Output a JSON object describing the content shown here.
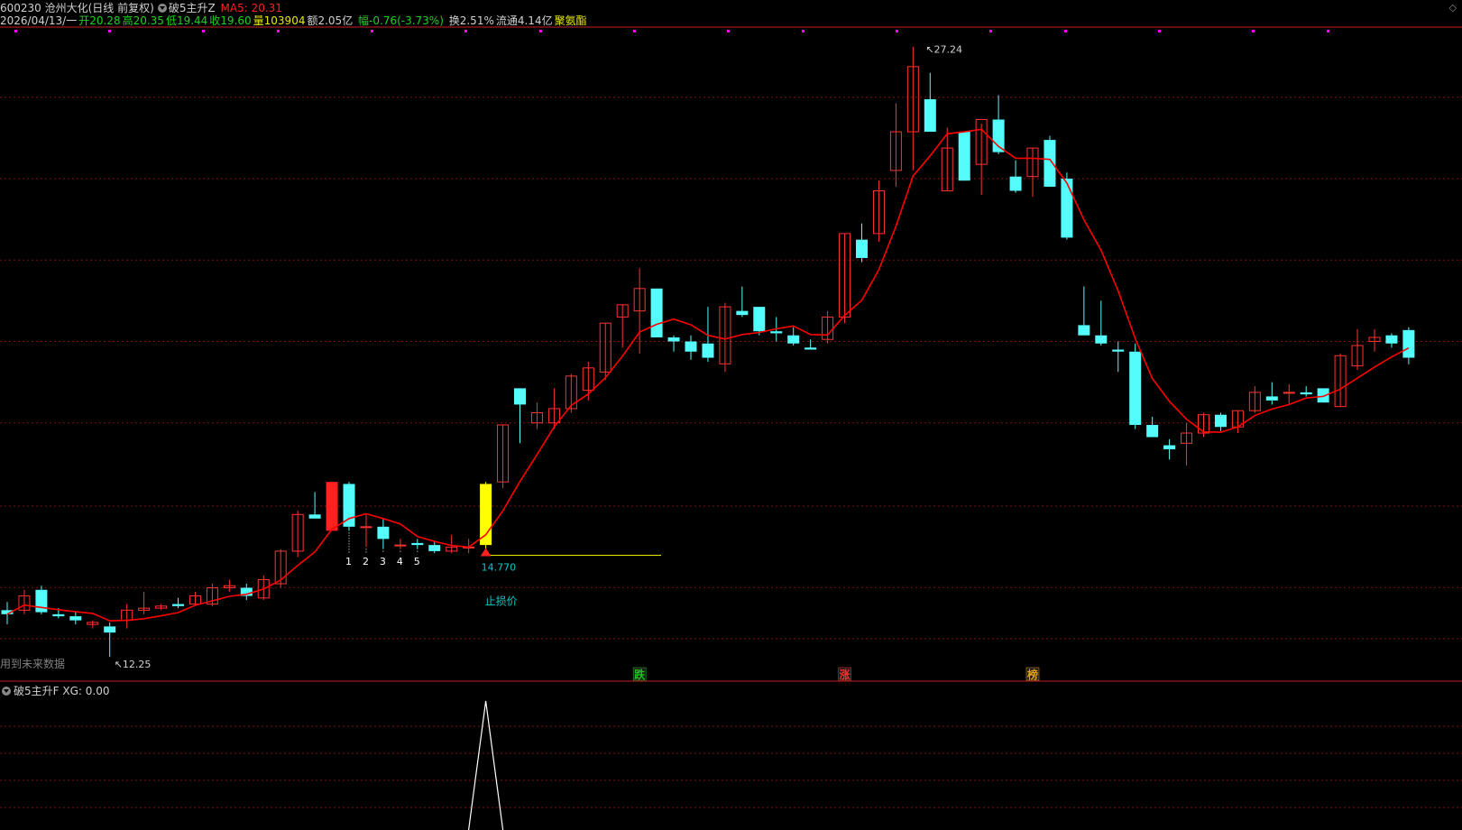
{
  "header": {
    "code_name": "600230 沧州大化(日线 前复权)",
    "indicator_name": "破5主升Z",
    "ma_label": "MA5: 20.31",
    "date": "2026/04/13/一",
    "open": "开20.28",
    "high": "高20.35",
    "low": "低19.44",
    "close": "收19.60",
    "volume": "量103904",
    "amount": "额2.05亿",
    "change": "幅-0.76(-3.73%)",
    "turnover": "换2.51%",
    "float_cap": "流通4.14亿",
    "concept": "聚氨酯"
  },
  "sub_panel": {
    "name": "破5主升F",
    "value": "XG: 0.00"
  },
  "note": "用到未来数据",
  "corner_icon": "diamond-icon",
  "colors": {
    "up": "#ff3232",
    "down": "#54fcfc",
    "ma": "#ff0000",
    "signal": "#ffff00",
    "grid": "#801010",
    "text_cyan": "#00c8c8"
  },
  "chart_data": [
    {
      "type": "candlestick",
      "ohlc": [
        [
          13.4,
          13.6,
          13.05,
          13.3
        ],
        [
          13.4,
          13.9,
          13.3,
          13.75
        ],
        [
          13.9,
          14.0,
          13.3,
          13.35
        ],
        [
          13.3,
          13.45,
          13.2,
          13.25
        ],
        [
          13.25,
          13.35,
          13.05,
          13.15
        ],
        [
          13.05,
          13.15,
          12.95,
          13.1
        ],
        [
          13.0,
          13.1,
          12.25,
          12.85
        ],
        [
          13.15,
          13.55,
          12.95,
          13.4
        ],
        [
          13.4,
          13.85,
          13.3,
          13.45
        ],
        [
          13.45,
          13.55,
          13.4,
          13.5
        ],
        [
          13.55,
          13.7,
          13.45,
          13.5
        ],
        [
          13.55,
          13.85,
          13.5,
          13.75
        ],
        [
          13.55,
          14.05,
          13.5,
          13.95
        ],
        [
          13.95,
          14.15,
          13.85,
          14.0
        ],
        [
          13.95,
          14.05,
          13.65,
          13.75
        ],
        [
          13.7,
          14.25,
          13.65,
          14.15
        ],
        [
          14.05,
          14.9,
          13.95,
          14.85
        ],
        [
          14.85,
          15.85,
          14.7,
          15.75
        ],
        [
          15.75,
          16.3,
          15.7,
          15.65
        ],
        [
          15.35,
          16.55,
          15.35,
          16.55
        ],
        [
          16.5,
          16.55,
          15.35,
          15.45
        ],
        [
          15.45,
          15.75,
          14.95,
          15.45
        ],
        [
          15.45,
          15.65,
          14.9,
          15.15
        ],
        [
          15.0,
          15.15,
          14.9,
          15.0
        ],
        [
          15.05,
          15.15,
          14.9,
          15.0
        ],
        [
          15.0,
          15.1,
          14.8,
          14.85
        ],
        [
          14.85,
          15.25,
          14.8,
          14.95
        ],
        [
          14.95,
          15.15,
          14.8,
          14.95
        ],
        [
          15.0,
          16.55,
          14.85,
          16.5
        ],
        [
          16.55,
          17.95,
          16.4,
          17.95
        ],
        [
          18.85,
          18.85,
          17.5,
          18.45
        ],
        [
          18.0,
          18.5,
          17.85,
          18.25
        ],
        [
          18.0,
          18.85,
          17.85,
          18.35
        ],
        [
          18.35,
          19.2,
          18.25,
          19.15
        ],
        [
          18.8,
          19.5,
          18.55,
          19.35
        ],
        [
          19.25,
          20.45,
          19.05,
          20.45
        ],
        [
          20.6,
          20.9,
          19.85,
          20.9
        ],
        [
          20.75,
          21.8,
          19.7,
          21.3
        ],
        [
          21.3,
          21.25,
          20.35,
          20.1
        ],
        [
          20.1,
          20.15,
          19.75,
          20.0
        ],
        [
          20.0,
          20.15,
          19.55,
          19.75
        ],
        [
          19.95,
          20.85,
          19.5,
          19.6
        ],
        [
          19.45,
          20.95,
          19.25,
          20.85
        ],
        [
          20.75,
          21.35,
          20.6,
          20.65
        ],
        [
          20.85,
          20.85,
          20.15,
          20.25
        ],
        [
          20.25,
          20.6,
          20.0,
          20.2
        ],
        [
          20.15,
          20.35,
          19.9,
          19.95
        ],
        [
          19.85,
          20.05,
          19.8,
          19.8
        ],
        [
          20.05,
          20.75,
          19.95,
          20.6
        ],
        [
          20.6,
          22.65,
          20.45,
          22.65
        ],
        [
          22.5,
          22.9,
          21.95,
          22.05
        ],
        [
          22.65,
          23.95,
          22.45,
          23.7
        ],
        [
          24.2,
          25.85,
          23.8,
          25.15
        ],
        [
          25.15,
          27.24,
          24.2,
          26.75
        ],
        [
          25.95,
          26.6,
          25.35,
          25.15
        ],
        [
          23.7,
          25.25,
          23.7,
          24.75
        ],
        [
          25.15,
          25.05,
          23.95,
          23.95
        ],
        [
          24.35,
          25.35,
          23.6,
          25.45
        ],
        [
          25.45,
          26.05,
          24.6,
          24.65
        ],
        [
          24.05,
          24.45,
          23.65,
          23.7
        ],
        [
          24.05,
          24.75,
          23.55,
          24.75
        ],
        [
          24.95,
          25.05,
          24.05,
          23.8
        ],
        [
          24.0,
          24.15,
          22.5,
          22.55
        ],
        [
          20.4,
          21.35,
          20.3,
          20.15
        ],
        [
          20.15,
          21.0,
          19.9,
          19.95
        ],
        [
          19.8,
          20.0,
          19.25,
          19.75
        ],
        [
          19.75,
          19.95,
          17.85,
          17.95
        ],
        [
          17.95,
          18.15,
          17.65,
          17.65
        ],
        [
          17.45,
          17.6,
          17.1,
          17.35
        ],
        [
          17.5,
          18.0,
          16.95,
          17.75
        ],
        [
          17.75,
          18.25,
          17.65,
          18.2
        ],
        [
          18.2,
          18.25,
          17.8,
          17.9
        ],
        [
          17.9,
          18.3,
          17.75,
          18.3
        ],
        [
          18.3,
          18.9,
          18.25,
          18.75
        ],
        [
          18.65,
          19.0,
          18.45,
          18.55
        ],
        [
          18.75,
          18.95,
          18.45,
          18.75
        ],
        [
          18.75,
          18.9,
          18.65,
          18.7
        ],
        [
          18.85,
          18.65,
          18.5,
          18.5
        ],
        [
          18.4,
          19.7,
          18.4,
          19.65
        ],
        [
          19.4,
          20.3,
          19.3,
          19.9
        ],
        [
          20.0,
          20.3,
          19.75,
          20.1
        ],
        [
          20.15,
          20.2,
          19.85,
          19.95
        ],
        [
          20.28,
          20.35,
          19.44,
          19.6
        ]
      ],
      "ma5_label": "MA5",
      "high_label": "27.24",
      "low_label": "12.25",
      "count_labels": [
        "1",
        "2",
        "3",
        "4",
        "5"
      ],
      "stop_label": "止损价",
      "stop_value_label": "14.770",
      "event_labels": [
        "跌",
        "涨",
        "榜"
      ],
      "ylim": [
        12.1,
        27.5
      ]
    },
    {
      "type": "line",
      "name": "XG",
      "signal_index": 28,
      "value": 1
    }
  ]
}
